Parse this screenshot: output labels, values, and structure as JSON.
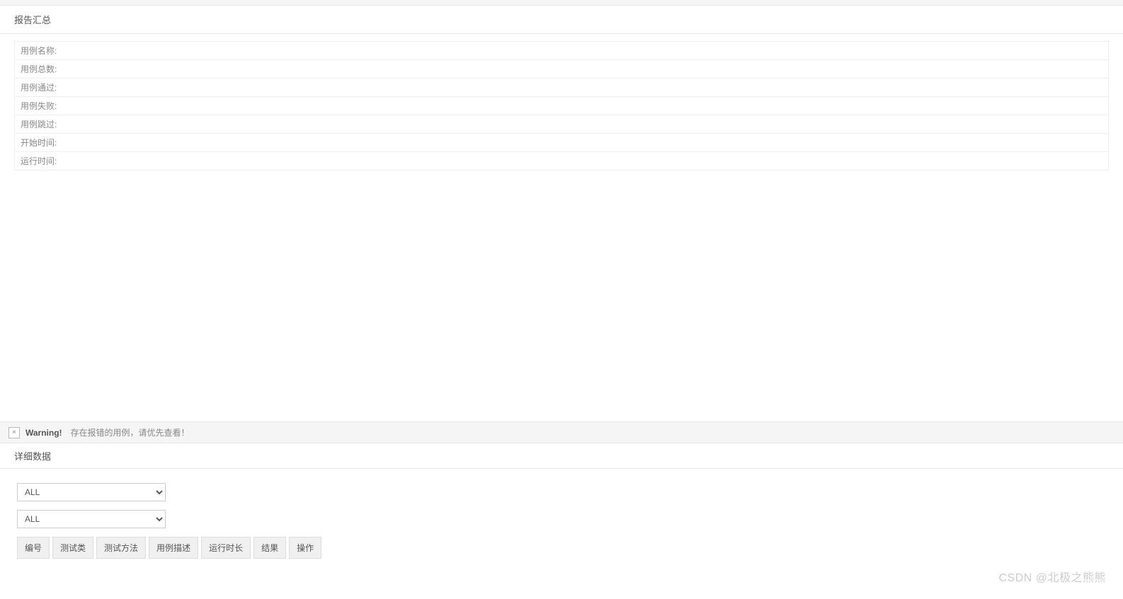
{
  "summary": {
    "title": "报告汇总",
    "rows": [
      "用例名称:",
      "用例总数:",
      "用例通过:",
      "用例失败:",
      "用例跳过:",
      "开始时间:",
      "运行时间:"
    ]
  },
  "warning": {
    "close": "×",
    "label": "Warning!",
    "text": "存在报错的用例，请优先查看！"
  },
  "detail": {
    "title": "详细数据",
    "select1": "ALL",
    "select2": "ALL",
    "columns": [
      "编号",
      "测试类",
      "测试方法",
      "用例描述",
      "运行时长",
      "结果",
      "操作"
    ]
  },
  "watermark": "CSDN @北极之熊熊"
}
